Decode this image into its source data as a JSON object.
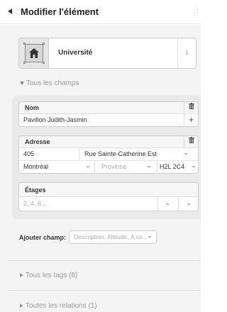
{
  "header": {
    "title": "Modifier l'élément",
    "back_icon": "back-arrow-icon",
    "right_mark": ":"
  },
  "preset": {
    "name": "Université",
    "icon": "building-icon",
    "info_label": "i"
  },
  "all_fields": {
    "toggle_label": "Tous les champs",
    "expanded": true,
    "fields": {
      "nom": {
        "label": "Nom",
        "value": "Pavillon Judith-Jasmin",
        "delete_icon": "trash-icon",
        "add_icon": "plus-icon",
        "add_label": "+"
      },
      "adresse": {
        "label": "Adresse",
        "housenumber": "405",
        "street": "Rue Sainte-Catherine Est",
        "city": "Montréal",
        "province_placeholder": "Province",
        "postcode": "H2L 2C4",
        "delete_icon": "trash-icon"
      },
      "etages": {
        "label": "Étages",
        "placeholder": "2, 4, 6..."
      }
    }
  },
  "add_field": {
    "label": "Ajouter champ:",
    "placeholder": "Description, Altitude, À co..."
  },
  "tags_section": {
    "label": "Tous les tags (8)",
    "expanded": false
  },
  "relations_section": {
    "label": "Toutes les relations (1)",
    "expanded": false
  },
  "colors": {
    "panel_bg": "#f4f4f4",
    "fields_bg": "#eaeaea",
    "muted_text": "#999999"
  }
}
